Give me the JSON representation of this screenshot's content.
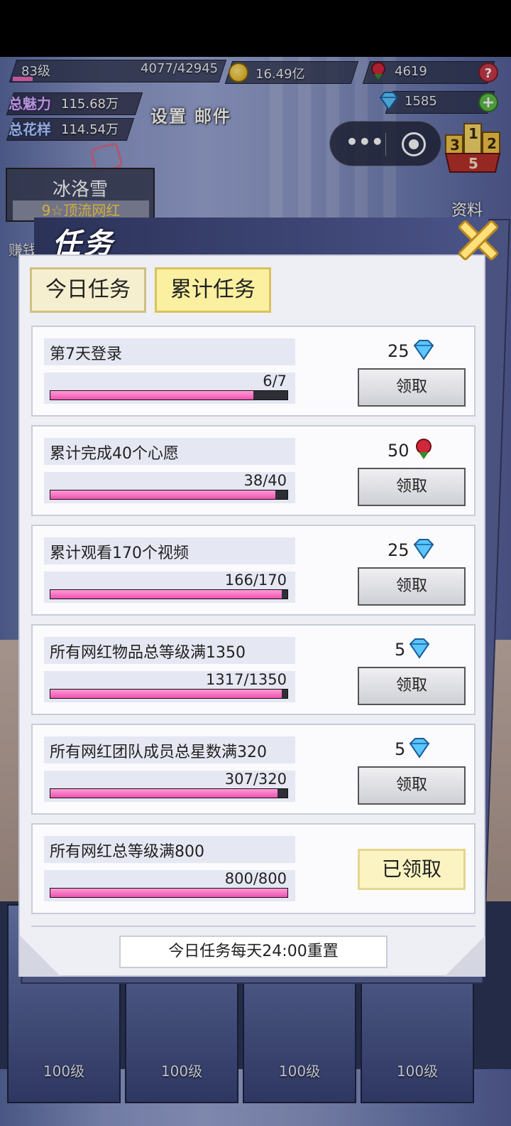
{
  "hud": {
    "level": "83级",
    "xp": "4077/42945",
    "gold": "16.49亿",
    "roses": "4619",
    "diamonds": "1585",
    "charm_label": "总魅力",
    "charm_value": "115.68万",
    "flower_label": "总花样",
    "flower_value": "114.54万",
    "settings_label": "设置",
    "mail_label": "邮件",
    "help_glyph": "?",
    "add_glyph": "+"
  },
  "capsule": {
    "more_glyph": "•••"
  },
  "rank": {
    "first": "1",
    "second": "2",
    "third": "3",
    "rank_value": "5"
  },
  "profile_label": "资料",
  "character": {
    "name": "冰洛雪",
    "title": "9☆顶流网红",
    "side_label": "赚钱"
  },
  "modal": {
    "title": "任务",
    "tabs": [
      {
        "label": "今日任务",
        "active": false
      },
      {
        "label": "累计任务",
        "active": true
      }
    ],
    "tasks": [
      {
        "name": "第7天登录",
        "progress_text": "6/7",
        "fraction": 0.857,
        "reward": "25",
        "reward_icon": "diamond-icon",
        "button": "领取",
        "claimed": false
      },
      {
        "name": "累计完成40个心愿",
        "progress_text": "38/40",
        "fraction": 0.95,
        "reward": "50",
        "reward_icon": "rose-icon",
        "button": "领取",
        "claimed": false
      },
      {
        "name": "累计观看170个视频",
        "progress_text": "166/170",
        "fraction": 0.976,
        "reward": "25",
        "reward_icon": "diamond-icon",
        "button": "领取",
        "claimed": false
      },
      {
        "name": "所有网红物品总等级满1350",
        "progress_text": "1317/1350",
        "fraction": 0.976,
        "reward": "5",
        "reward_icon": "diamond-icon",
        "button": "领取",
        "claimed": false
      },
      {
        "name": "所有网红团队成员总星数满320",
        "progress_text": "307/320",
        "fraction": 0.959,
        "reward": "5",
        "reward_icon": "diamond-icon",
        "button": "领取",
        "claimed": false
      },
      {
        "name": "所有网红总等级满800",
        "progress_text": "800/800",
        "fraction": 1.0,
        "reward": "",
        "reward_icon": "",
        "button": "已领取",
        "claimed": true
      }
    ],
    "footer_note": "今日任务每天24:00重置"
  },
  "cards": [
    {
      "level": "100级"
    },
    {
      "level": "100级"
    },
    {
      "level": "100级"
    },
    {
      "level": "100级"
    }
  ],
  "colors": {
    "progress_fill": "#ef52b0",
    "tab_active": "#fbf0a0",
    "claimed_bg": "#fbf4c2",
    "close_x": "#ffe07a"
  }
}
